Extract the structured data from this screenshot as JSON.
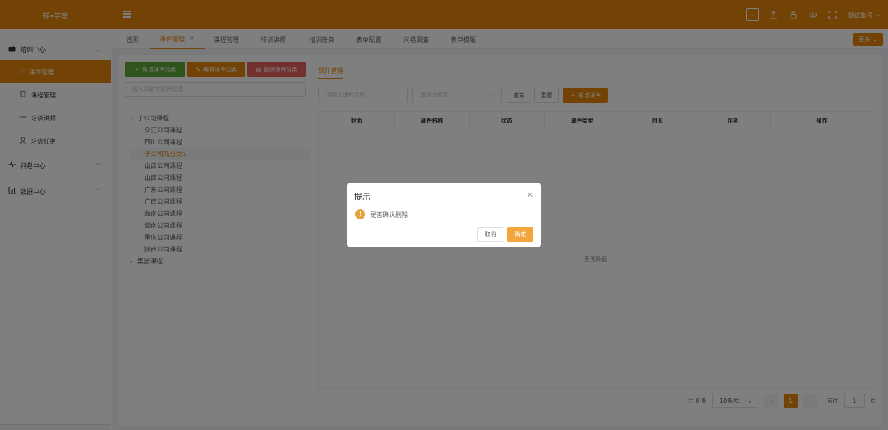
{
  "brand": {
    "name": "祥•学堂",
    "accent": "#e6870b"
  },
  "header": {
    "user_name": "测试账号"
  },
  "sidebar": {
    "groups": [
      {
        "label": "培训中心",
        "icon": "bag-icon"
      },
      {
        "label": "问卷中心",
        "icon": "pulse-icon"
      },
      {
        "label": "数据中心",
        "icon": "chart-icon"
      }
    ],
    "items": [
      {
        "label": "课件管理",
        "icon": "heart-icon"
      },
      {
        "label": "课程管理",
        "icon": "shirt-icon"
      },
      {
        "label": "培训讲师",
        "icon": "key-icon"
      },
      {
        "label": "培训任务",
        "icon": "user-icon"
      }
    ]
  },
  "tabs": [
    {
      "label": "首页"
    },
    {
      "label": "课件管理"
    },
    {
      "label": "课程管理"
    },
    {
      "label": "培训讲师"
    },
    {
      "label": "培训任务"
    },
    {
      "label": "表单配置"
    },
    {
      "label": "问卷调查"
    },
    {
      "label": "表单模版"
    }
  ],
  "more_label": "更多",
  "left_panel": {
    "add_btn": "新增课件分类",
    "edit_btn": "编辑课件分类",
    "delete_btn": "删除课件分类",
    "filter_placeholder": "输入关键字进行过滤",
    "tree": {
      "root1": "子公司课程",
      "children": [
        "众汇公司课程",
        "四川公司课程",
        "子公司新分类1",
        "山西公司课程",
        "山西公司课程",
        "广东公司课程",
        "广西公司课程",
        "海南公司课程",
        "湖南公司课程",
        "重庆公司课程",
        "陕西公司课程"
      ],
      "root2": "集团课程"
    }
  },
  "right_panel": {
    "title": "课件管理",
    "name_placeholder": "请输入课件名称",
    "status_placeholder": "请选择状态",
    "query_btn": "查询",
    "reset_btn": "重置",
    "add_btn": "新增课件",
    "columns": [
      "封面",
      "课件名称",
      "状态",
      "课件类型",
      "时长",
      "作者",
      "操作"
    ],
    "empty_text": "暂无数据"
  },
  "pagination": {
    "total": "共 0 条",
    "page_size": "10条/页",
    "current_page": "1",
    "goto_label": "前往",
    "goto_value": "1",
    "page_unit": "页"
  },
  "dialog": {
    "title": "提示",
    "message": "是否确认删除",
    "cancel": "取消",
    "confirm": "确定"
  }
}
